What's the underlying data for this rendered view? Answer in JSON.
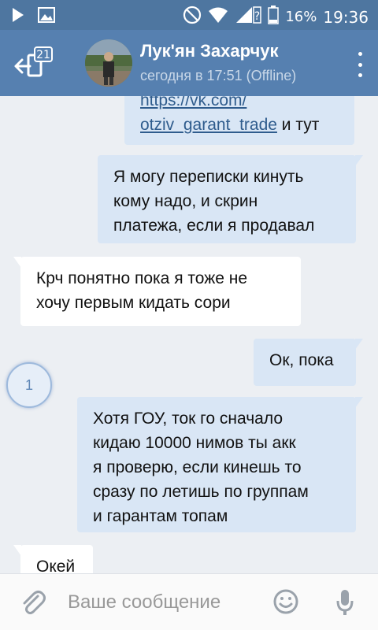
{
  "status_bar": {
    "battery": "16%",
    "time": "19:36"
  },
  "header": {
    "unread_badge": "21",
    "contact_name": "Лук'ян Захарчук",
    "last_seen": "сегодня в 17:51 (Offline)"
  },
  "messages": [
    {
      "direction": "out",
      "link_line1": "https://vk.com/",
      "link_line2": "otziv_garant_trade",
      "suffix": " и тут"
    },
    {
      "direction": "out",
      "lines": [
        "Я могу переписки кинуть",
        "кому надо, и скрин",
        "платежа, если я продавал"
      ]
    },
    {
      "direction": "in",
      "lines": [
        "Крч понятно пока я тоже не",
        "хочу первым кидать сори"
      ]
    },
    {
      "direction": "out",
      "lines": [
        "Ок, пока"
      ]
    },
    {
      "direction": "out",
      "lines": [
        "Хотя ГОУ, ток го сначало",
        "кидаю 10000 нимов ты акк",
        "я проверю, если кинешь то",
        "сразу по летишь по группам",
        "и гарантам топам"
      ]
    },
    {
      "direction": "in",
      "lines": [
        "Окей"
      ]
    }
  ],
  "unread_indicator": "1",
  "input": {
    "placeholder": "Ваше сообщение",
    "value": ""
  },
  "colors": {
    "status_bar": "#4e76a0",
    "header": "#5680b0",
    "outgoing_bubble": "#d9e6f5",
    "incoming_bubble": "#ffffff",
    "chat_background": "#eceff3"
  },
  "icons": [
    "play-icon",
    "image-icon",
    "dnd-icon",
    "wifi-icon",
    "signal-icon",
    "battery-icon",
    "back-icon",
    "more-vertical-icon",
    "attach-icon",
    "emoji-icon",
    "microphone-icon"
  ]
}
